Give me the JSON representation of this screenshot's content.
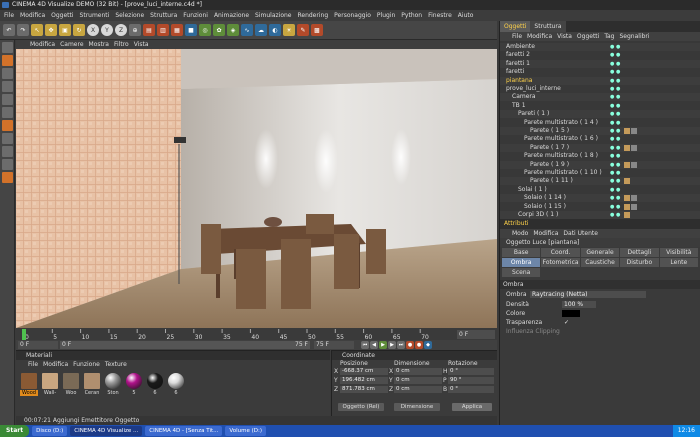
{
  "title": "CINEMA 4D Visualize DEMO (32 Bit) - [prove_luci_interne.c4d *]",
  "menu": [
    "File",
    "Modifica",
    "Oggetti",
    "Strumenti",
    "Selezione",
    "Struttura",
    "Funzioni",
    "Animazione",
    "Simulazione",
    "Rendering",
    "Personaggio",
    "Plugin",
    "Python",
    "Finestre",
    "Aiuto"
  ],
  "viewport_menu": [
    "Modifica",
    "Camere",
    "Mostra",
    "Filtro",
    "Vista"
  ],
  "timeline": {
    "ticks": [
      "0",
      "5",
      "10",
      "15",
      "20",
      "25",
      "30",
      "35",
      "40",
      "45",
      "50",
      "55",
      "60",
      "65",
      "70"
    ],
    "end_field": "0 F",
    "start": "0 F",
    "current": "0 F",
    "range_end": "75 F",
    "max": "75 F"
  },
  "object_manager": {
    "tabs": [
      "Oggetti",
      "Struttura"
    ],
    "menu": [
      "File",
      "Modifica",
      "Vista",
      "Oggetti",
      "Tag",
      "Segnalibri"
    ],
    "objects": [
      {
        "label": "Ambiente",
        "indent": 0,
        "tags": 0
      },
      {
        "label": "faretti 2",
        "indent": 0,
        "tags": 0
      },
      {
        "label": "faretti 1",
        "indent": 0,
        "tags": 0
      },
      {
        "label": "faretti",
        "indent": 0,
        "tags": 0
      },
      {
        "label": "piantana",
        "indent": 0,
        "tags": 0,
        "highlight": true
      },
      {
        "label": "prove_luci_interne",
        "indent": 0,
        "tags": 0
      },
      {
        "label": "Camera",
        "indent": 1,
        "tags": 0
      },
      {
        "label": "TB 1",
        "indent": 1,
        "tags": 0
      },
      {
        "label": "Pareti ( 1 )",
        "indent": 2,
        "tags": 0
      },
      {
        "label": "Parete multistrato ( 1 4 )",
        "indent": 3,
        "tags": 0
      },
      {
        "label": "Parete ( 1 5 )",
        "indent": 4,
        "tags": 2
      },
      {
        "label": "Parete multistrato ( 1 6 )",
        "indent": 3,
        "tags": 0
      },
      {
        "label": "Parete ( 1 7 )",
        "indent": 4,
        "tags": 2
      },
      {
        "label": "Parete multistrato ( 1 8 )",
        "indent": 3,
        "tags": 0
      },
      {
        "label": "Parete ( 1 9 )",
        "indent": 4,
        "tags": 2
      },
      {
        "label": "Parete multistrato ( 1 10 )",
        "indent": 3,
        "tags": 0
      },
      {
        "label": "Parete ( 1 11 )",
        "indent": 4,
        "tags": 1
      },
      {
        "label": "Solai ( 1 )",
        "indent": 2,
        "tags": 0
      },
      {
        "label": "Solaio ( 1 14 )",
        "indent": 3,
        "tags": 2
      },
      {
        "label": "Solaio ( 1 15 )",
        "indent": 3,
        "tags": 2
      },
      {
        "label": "Corpi 3D ( 1 )",
        "indent": 2,
        "tags": 1
      }
    ]
  },
  "attributes": {
    "tab": "Attributi",
    "menu": [
      "Modo",
      "Modifica",
      "Dati Utente"
    ],
    "object_title": "Oggetto Luce [piantana]",
    "groups": [
      "Base",
      "Coord.",
      "Generale",
      "Dettagli",
      "Visibilità",
      "Ombra",
      "Fotometrica",
      "Caustiche",
      "Disturbo",
      "Lente",
      "Scena"
    ],
    "selected_group": "Ombra",
    "section": "Ombra",
    "shadow_label": "Ombra",
    "shadow_value": "Raytracing (Netta)",
    "props": [
      {
        "label": "Densità",
        "value": "100 %"
      },
      {
        "label": "Colore",
        "value": ""
      },
      {
        "label": "Trasparenza",
        "value": "✓"
      },
      {
        "label": "Influenza Clipping",
        "value": ""
      }
    ]
  },
  "materials": {
    "title": "Materiali",
    "menu": [
      "File",
      "Modifica",
      "Funzione",
      "Texture"
    ],
    "items": [
      {
        "label": "Wood",
        "color": "#8a5a34",
        "selected": true
      },
      {
        "label": "Wall-",
        "color": "#c9a680"
      },
      {
        "label": "Woo",
        "color": "#7a6a56"
      },
      {
        "label": "Ceran",
        "color": "#b08f6f"
      },
      {
        "label": "Ston",
        "color": "#9a9a9a"
      },
      {
        "label": "5",
        "color": "#b0128a"
      },
      {
        "label": "6",
        "color": "#1a1a1a"
      },
      {
        "label": "6",
        "color": "#dcdcdc"
      }
    ]
  },
  "coordinates": {
    "title": "Coordinate",
    "headers": [
      "Posizione",
      "Dimensione",
      "Rotazione"
    ],
    "rows": [
      {
        "axis": "X",
        "pos": "-668.37 cm",
        "dimAxis": "X",
        "dim": "0 cm",
        "rotAxis": "H",
        "rot": "0 °"
      },
      {
        "axis": "Y",
        "pos": "196.482 cm",
        "dimAxis": "Y",
        "dim": "0 cm",
        "rotAxis": "P",
        "rot": "90 °"
      },
      {
        "axis": "Z",
        "pos": "871.783 cm",
        "dimAxis": "Z",
        "dim": "0 cm",
        "rotAxis": "B",
        "rot": "0 °"
      }
    ],
    "mode_left": "Oggetto (Rel)",
    "mode_right": "Dimensione",
    "apply": "Applica"
  },
  "status": "00:07:21  Aggiungi Emettitore Oggetto",
  "taskbar": {
    "start": "Start",
    "tasks": [
      {
        "label": "Disco (D:)",
        "active": false
      },
      {
        "label": "CINEMA 4D Visualize ...",
        "active": true
      },
      {
        "label": "CINEMA 4D - [Senza Tit...",
        "active": false
      },
      {
        "label": "Volume (D:)",
        "active": false
      }
    ],
    "clock": "12:16"
  },
  "accent": "#ffd24a"
}
